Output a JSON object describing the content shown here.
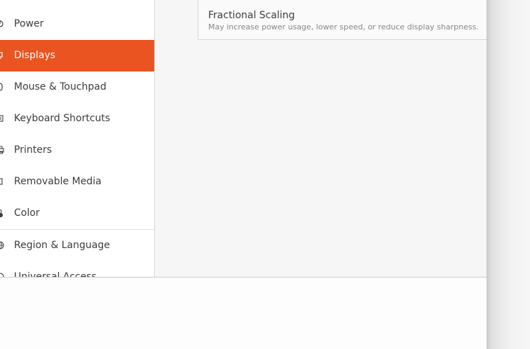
{
  "sidebar": {
    "items": [
      {
        "label": "Power",
        "icon": "power-icon"
      },
      {
        "label": "Displays",
        "icon": "display-icon",
        "active": true
      },
      {
        "label": "Mouse & Touchpad",
        "icon": "mouse-icon"
      },
      {
        "label": "Keyboard Shortcuts",
        "icon": "keyboard-icon"
      },
      {
        "label": "Printers",
        "icon": "printer-icon"
      },
      {
        "label": "Removable Media",
        "icon": "media-icon"
      },
      {
        "label": "Color",
        "icon": "color-icon"
      },
      {
        "label": "Region & Language",
        "icon": "globe-icon"
      },
      {
        "label": "Universal Access",
        "icon": "accessibility-icon"
      }
    ]
  },
  "main": {
    "fractional_scaling": {
      "title": "Fractional Scaling",
      "subtitle": "May increase power usage, lower speed, or reduce display sharpness."
    }
  },
  "colors": {
    "accent": "#e95420",
    "sidebar_bg": "#ffffff",
    "content_bg": "#f6f6f6"
  }
}
